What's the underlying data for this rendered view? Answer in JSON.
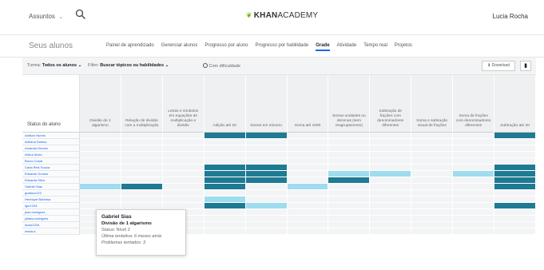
{
  "topbar": {
    "subjects_label": "Assuntos",
    "subjects_chevron": "⌄",
    "logo_leaf": "❦",
    "logo_text": "KHAN",
    "logo_text2": "ACADEMY",
    "user_name": "Lucia Rocha"
  },
  "subnav": {
    "section_title": "Seus alunos",
    "tabs": [
      {
        "label": "Painel de aprendizado",
        "active": false
      },
      {
        "label": "Gerenciar alunos",
        "active": false
      },
      {
        "label": "Progresso por aluno",
        "active": false
      },
      {
        "label": "Progresso por habilidade",
        "active": false
      },
      {
        "label": "Grade",
        "active": true
      },
      {
        "label": "Atividade",
        "active": false
      },
      {
        "label": "Tempo real",
        "active": false
      },
      {
        "label": "Projetos",
        "active": false
      }
    ]
  },
  "filters": {
    "turma_label": "Turma:",
    "turma_value": "Todos os alunos",
    "filtro_label": "Filtro:",
    "filtro_value": "Buscar tópicos ou habilidades",
    "difficulty_label": "Com dificuldade",
    "download_label": "Download",
    "chevron": "⌄"
  },
  "grid": {
    "status_header": "Status do aluno",
    "columns": [
      "Divisão de 1 algarismo",
      "Relação de divisão com a multiplicação",
      "Letras e símbolos em equações de multiplicação e divisão",
      "Adição até 20",
      "Somar em número",
      "Soma até 1000",
      "Somar unidades ou dezenas (sem reagrupamento)",
      "Subtração de frações com denominadores diferentes",
      "Soma e subtração visual de frações",
      "Soma de frações com denominadores diferentes",
      "Subtração até 20"
    ],
    "students": [
      "Adilson Nunes",
      "Adriana Santos",
      "Amanda Gomes",
      "Arthur Alves",
      "Bruno Costa",
      "Carla Reis Souza",
      "Eduardo Gomes",
      "Eduarda Silva",
      "Gabriel Sias",
      "gustavo123",
      "Henrique Barbosa",
      "igor1234",
      "joao.rodrigues",
      "juliana.rodrigues",
      "lucas1234",
      "maria.a"
    ],
    "cell_states": [
      [
        0,
        0,
        0,
        2,
        2,
        0,
        0,
        0,
        0,
        0,
        2
      ],
      [
        0,
        0,
        0,
        0,
        0,
        0,
        0,
        0,
        0,
        0,
        0
      ],
      [
        0,
        0,
        0,
        0,
        0,
        0,
        0,
        0,
        0,
        0,
        0
      ],
      [
        0,
        0,
        0,
        0,
        0,
        0,
        0,
        0,
        0,
        0,
        0
      ],
      [
        0,
        0,
        0,
        0,
        0,
        0,
        0,
        0,
        0,
        0,
        0
      ],
      [
        0,
        0,
        0,
        2,
        2,
        0,
        0,
        0,
        0,
        0,
        2
      ],
      [
        0,
        0,
        0,
        2,
        2,
        0,
        1,
        1,
        0,
        1,
        2
      ],
      [
        0,
        0,
        0,
        2,
        2,
        0,
        2,
        0,
        0,
        0,
        2
      ],
      [
        1,
        2,
        0,
        2,
        0,
        1,
        0,
        0,
        0,
        0,
        2
      ],
      [
        0,
        0,
        0,
        0,
        0,
        0,
        0,
        0,
        0,
        0,
        0
      ],
      [
        0,
        0,
        0,
        1,
        0,
        0,
        0,
        0,
        0,
        0,
        0
      ],
      [
        0,
        0,
        0,
        2,
        1,
        0,
        0,
        0,
        0,
        0,
        2
      ],
      [
        0,
        0,
        0,
        0,
        0,
        0,
        0,
        0,
        0,
        0,
        0
      ],
      [
        0,
        0,
        0,
        0,
        0,
        0,
        0,
        0,
        0,
        0,
        0
      ],
      [
        0,
        0,
        0,
        0,
        0,
        0,
        0,
        0,
        0,
        0,
        0
      ],
      [
        0,
        0,
        0,
        0,
        0,
        0,
        0,
        0,
        0,
        0,
        0
      ]
    ],
    "colors": {
      "empty": "#f3f4f5",
      "light": "#9fdcef",
      "dark": "#1f7a93"
    }
  },
  "tooltip": {
    "name": "Gabriel Sias",
    "skill": "Divisão de 1 algarismo",
    "status": "Status: Nível 2",
    "last_try": "Última tentativa: 6 meses atrás",
    "problems": "Problemas tentados: 3"
  }
}
